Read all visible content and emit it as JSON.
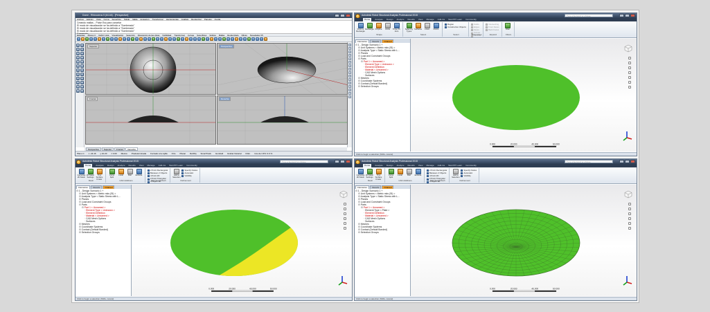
{
  "rhino": {
    "title": "Dome - Rhinoceros 5 (64-bit) - [Perspective]",
    "menu": [
      "Archivo",
      "Edición",
      "Vista",
      "Curva",
      "Superficie",
      "Sólido",
      "Malla",
      "Acotación",
      "Transformar",
      "Herramientas",
      "Análisis",
      "Renderizar",
      "Paneles",
      "Ayuda"
    ],
    "command_history": [
      "Creando mallas... Pulse Esc para cancelar",
      "El modo de visualización se ha definido a \"Sombreado\"",
      "El modo de visualización se ha definido a \"Sombreado\"",
      "El modo de visualización se ha definido a \"Sombreado\""
    ],
    "command_prompt": "Comando:",
    "toolbar_tabs": [
      "Estándar",
      "Planos C",
      "Definir vista",
      "Visualización",
      "Selección",
      "Disposición de las vistas",
      "Visibilidad",
      "Transformar",
      "Curvas",
      "Superficies",
      "Sólidos",
      "Mallas",
      "Renderizado",
      "Dibujo",
      "Novedades V5"
    ],
    "viewports": [
      {
        "label": "Superior"
      },
      {
        "label": "Perspectiva"
      },
      {
        "label": "Frontal"
      },
      {
        "label": "Derecha"
      }
    ],
    "viewport_tabs": [
      "Perspectiva",
      "Superior",
      "Frontal",
      "Derecha"
    ],
    "status": [
      "Plano C",
      "x -44.16",
      "y 10.20",
      "z 0.00",
      "Metros",
      "Predeterminada",
      "Forzado a la rejilla",
      "Orto",
      "Planar",
      "RefObj",
      "SmartTrack",
      "Gumball",
      "Grabar historial",
      "Filtro",
      "Uso de CPU: 0.0 %"
    ]
  },
  "robot": {
    "title": "Autodesk Robot Structural Analysis Professional 2015",
    "search_placeholder": "Type a keyword or phrase",
    "tabs": [
      "Home",
      "Analysis",
      "Design",
      "Analyze",
      "Results",
      "View",
      "Manage",
      "Add-ins",
      "Start BT Learn",
      "Community"
    ],
    "ribbon_a": {
      "groups": [
        {
          "label": "Shape",
          "buttons": [
            "Point or Rectangle",
            "Rectangle",
            "Polyline",
            "Circle",
            "Three Pt. Arcs"
          ]
        },
        {
          "label": "Select",
          "buttons": [
            "Select by Types",
            "Surfaces",
            "Lines",
            "Points"
          ]
        },
        {
          "label": "Select",
          "list": [
            "Region",
            "Construction Objects"
          ]
        },
        {
          "label": "Subentities",
          "list": [
            "Solids",
            "Edges",
            "Faces",
            "Curves",
            "Vertices"
          ]
        },
        {
          "label": "Expand",
          "list": [
            "Intersecting",
            "Front Faces",
            "Back Faces"
          ]
        },
        {
          "label": "Filters",
          "buttons": [
            "Filter"
          ]
        }
      ]
    },
    "ribbon_b": {
      "groups": [
        {
          "label": "Mesh",
          "buttons": [
            "Generate 2D Mesh",
            "2D Mesh Settings",
            "Tiny Surface Finder"
          ]
        },
        {
          "label": "CAD Additions",
          "buttons": [
            "Curve Split",
            "Local",
            "Bolt",
            "Extrude"
          ]
        },
        {
          "label": "Structured Mesh",
          "list": [
            "2 Point Rectangular",
            "Between 2 Objects",
            "4 Point 2D",
            "2 Point Triangular",
            "4 Object 3D",
            "Divide 1 Object"
          ]
        },
        {
          "label": "Refinement",
          "buttons": [
            "Add to Selection"
          ],
          "list": [
            "Specify Nodes",
            "Automatic",
            "Visibility"
          ]
        }
      ]
    },
    "panel_tabs": [
      "FEA Editor",
      "Results",
      "Ordered"
    ],
    "tree": [
      {
        "text": "1 - Design Scenario 1 +",
        "level": 0
      },
      {
        "text": "Unit Systems < Metric mks (SI) >",
        "level": 1
      },
      {
        "text": "Analysis Type < Static Stress with L...",
        "level": 1
      },
      {
        "text": "Planes",
        "level": 1
      },
      {
        "text": "Load and Constraint Groups",
        "level": 1
      },
      {
        "text": "Parts",
        "level": 1
      },
      {
        "text": "Part 1 < Unnamed >",
        "level": 2,
        "red": true
      },
      {
        "text": "Element Type < Unknown >",
        "level": 3,
        "red": true
      },
      {
        "text": "Element Definition",
        "level": 3,
        "red": true
      },
      {
        "text": "Material < Unnamed >",
        "level": 3,
        "red": true
      },
      {
        "text": "CAD Mesh Options",
        "level": 3
      },
      {
        "text": "Surfaces",
        "level": 3
      },
      {
        "text": "Meshes",
        "level": 1
      },
      {
        "text": "Coordinate Systems",
        "level": 1
      },
      {
        "text": "Contact (Default Bonded)",
        "level": 1
      },
      {
        "text": "Selection Groups",
        "level": 1
      }
    ],
    "tree_plate": [
      {
        "text": "1 - Design Scenario 1 +",
        "level": 0
      },
      {
        "text": "Unit Systems < Metric mks (SI) >",
        "level": 1
      },
      {
        "text": "Analysis Type < Static Stress with L...",
        "level": 1
      },
      {
        "text": "Planes",
        "level": 1
      },
      {
        "text": "Load and Constraint Groups",
        "level": 1
      },
      {
        "text": "Parts",
        "level": 1
      },
      {
        "text": "Part 1 < Unnamed >",
        "level": 2,
        "red": true
      },
      {
        "text": "Element Type < Plate >",
        "level": 3
      },
      {
        "text": "Element Definition",
        "level": 3,
        "red": true
      },
      {
        "text": "Material < Unnamed >",
        "level": 3,
        "red": true
      },
      {
        "text": "CAD Mesh Options",
        "level": 3
      },
      {
        "text": "Surfaces",
        "level": 3
      },
      {
        "text": "Meshes",
        "level": 1
      },
      {
        "text": "Coordinate Systems",
        "level": 1
      },
      {
        "text": "Contact (Default Bonded)",
        "level": 1
      },
      {
        "text": "Selection Groups",
        "level": 1
      }
    ],
    "status": "Click to begin a selection (Shift+ cancel)",
    "scale_labels": [
      "0.000",
      "20.000",
      "40.000",
      "60.000"
    ],
    "colors": {
      "dome_green": "#4fc02a",
      "dome_yellow": "#ece625",
      "mesh_line": "#3f7a2a"
    }
  }
}
